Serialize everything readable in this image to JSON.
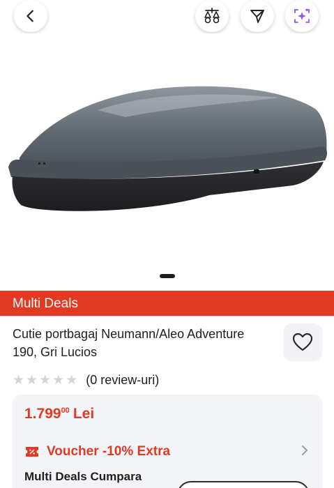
{
  "header": {
    "back_icon": "chevron-left-icon",
    "compare_icon": "compare-scale-icon",
    "share_icon": "send-icon",
    "ai_icon": "ai-sparkle-icon"
  },
  "gallery": {
    "image_alt": "Cutie portbagaj Neumann/Aleo Adventure 190, Gri Lucios",
    "active_slide": 1
  },
  "store": {
    "name": "Multi Deals",
    "color": "#e23a22"
  },
  "product": {
    "title": "Cutie portbagaj Neumann/Aleo Adventure 190, Gri Lucios",
    "rating": 0,
    "stars_max": 5,
    "review_text": "(0 review-uri)"
  },
  "price": {
    "main": "1.799",
    "decimals": "00",
    "currency": "Lei"
  },
  "voucher": {
    "label": "Voucher -10% Extra"
  },
  "seller": {
    "label": "Multi Deals Cumpara"
  }
}
